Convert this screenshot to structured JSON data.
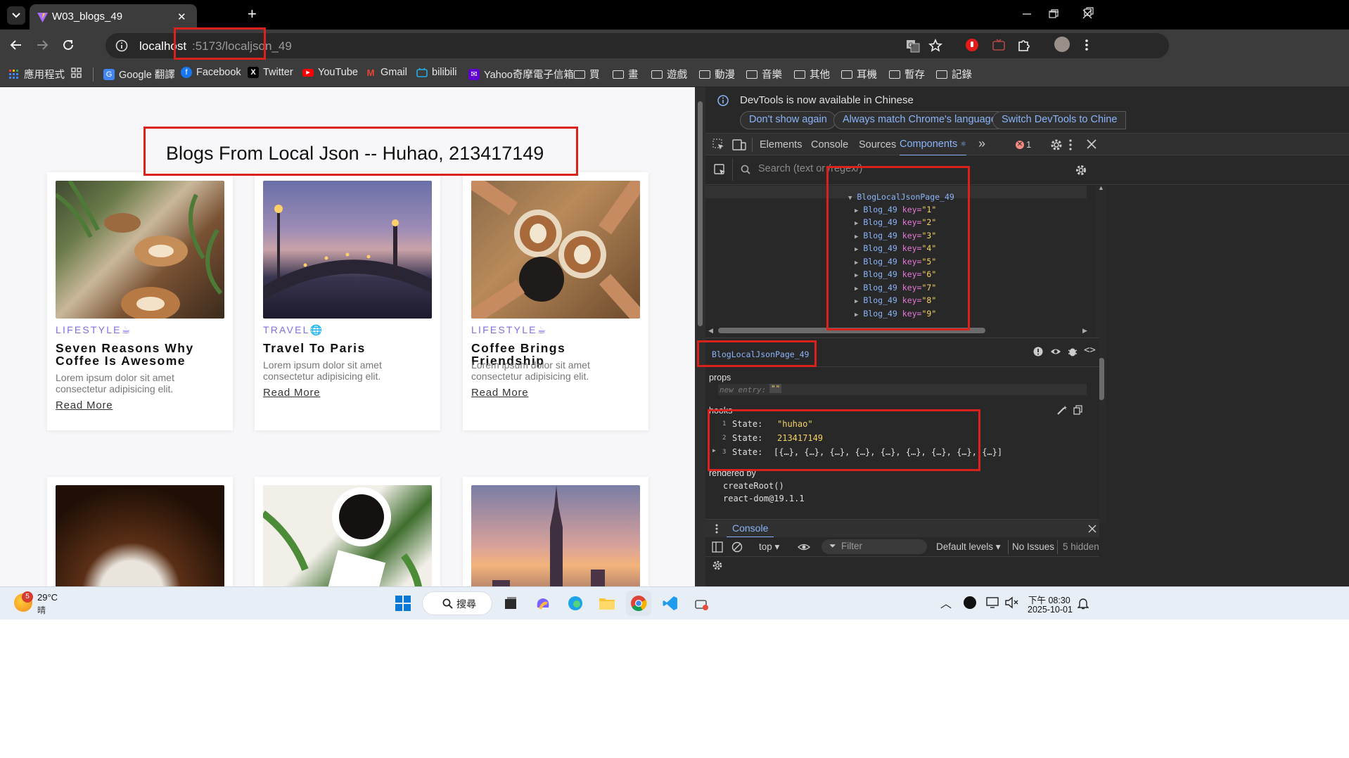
{
  "tab": {
    "title": "W03_blogs_49",
    "close": "✕",
    "new": "+"
  },
  "address": {
    "host": "localhost",
    "rest": ":5173/localjson_49"
  },
  "bookmarks": [
    {
      "label": "應用程式",
      "icon": "apps-grid-icon"
    },
    {
      "label": "",
      "icon": "grid-icon"
    },
    {
      "label": "Google 翻譯",
      "icon": "google-translate-icon"
    },
    {
      "label": "Facebook",
      "icon": "facebook-icon"
    },
    {
      "label": "Twitter",
      "icon": "x-twitter-icon"
    },
    {
      "label": "YouTube",
      "icon": "youtube-icon"
    },
    {
      "label": "Gmail",
      "icon": "gmail-icon"
    },
    {
      "label": "bilibili",
      "icon": "bilibili-icon"
    },
    {
      "label": "Yahoo奇摩電子信箱",
      "icon": "yahoo-icon"
    },
    {
      "label": "買",
      "icon": "folder-icon"
    },
    {
      "label": "畫",
      "icon": "folder-icon"
    },
    {
      "label": "遊戲",
      "icon": "folder-icon"
    },
    {
      "label": "動漫",
      "icon": "folder-icon"
    },
    {
      "label": "音樂",
      "icon": "folder-icon"
    },
    {
      "label": "其他",
      "icon": "folder-icon"
    },
    {
      "label": "耳機",
      "icon": "folder-icon"
    },
    {
      "label": "暫存",
      "icon": "folder-icon"
    },
    {
      "label": "記錄",
      "icon": "folder-icon"
    }
  ],
  "page": {
    "title": "Blogs From Local Json -- Huhao, 213417149",
    "cards": [
      {
        "category": "LIFESTYLE",
        "cat_icon": "coffee-cup-icon",
        "title": "Seven Reasons Why Coffee Is Awesome",
        "desc": "Lorem ipsum dolor sit amet consectetur adipisicing elit.",
        "link": "Read More"
      },
      {
        "category": "TRAVEL",
        "cat_icon": "globe-icon",
        "title": "Travel To Paris",
        "desc": "Lorem ipsum dolor sit amet consectetur adipisicing elit.",
        "link": "Read More"
      },
      {
        "category": "LIFESTYLE",
        "cat_icon": "coffee-cup-icon",
        "title": "Coffee Brings Friendship",
        "desc": "Lorem ipsum dolor sit amet consectetur adipisicing elit.",
        "link": "Read More"
      }
    ]
  },
  "devtools": {
    "info": "DevTools is now available in Chinese",
    "btn_dont_show": "Don't show again",
    "btn_match": "Always match Chrome's language",
    "btn_switch": "Switch DevTools to Chine",
    "tabs": [
      "Elements",
      "Console",
      "Sources",
      "Components"
    ],
    "error_count": "1",
    "search_placeholder": "Search (text or /regex/)",
    "tree_root": "BlogLocalJsonPage_49",
    "tree_children": [
      {
        "name": "Blog_49",
        "key": "key=",
        "val": "\"1\""
      },
      {
        "name": "Blog_49",
        "key": "key=",
        "val": "\"2\""
      },
      {
        "name": "Blog_49",
        "key": "key=",
        "val": "\"3\""
      },
      {
        "name": "Blog_49",
        "key": "key=",
        "val": "\"4\""
      },
      {
        "name": "Blog_49",
        "key": "key=",
        "val": "\"5\""
      },
      {
        "name": "Blog_49",
        "key": "key=",
        "val": "\"6\""
      },
      {
        "name": "Blog_49",
        "key": "key=",
        "val": "\"7\""
      },
      {
        "name": "Blog_49",
        "key": "key=",
        "val": "\"8\""
      },
      {
        "name": "Blog_49",
        "key": "key=",
        "val": "\"9\""
      }
    ],
    "selected": "BlogLocalJsonPage_49",
    "props_label": "props",
    "new_entry": "new entry:",
    "new_entry_val": "\"\"",
    "hooks_label": "hooks",
    "hooks": [
      {
        "idx": "1",
        "label": "State:",
        "val": "\"huhao\""
      },
      {
        "idx": "2",
        "label": "State:",
        "val": "213417149"
      },
      {
        "idx": "3",
        "label": "State:",
        "val": "[{…}, {…}, {…}, {…}, {…}, {…}, {…}, {…}, {…}]"
      }
    ],
    "rendered_by": "rendered by",
    "rendered_items": [
      "createRoot()",
      "react-dom@19.1.1"
    ],
    "console_tab": "Console",
    "console_top": "top ▾",
    "filter_placeholder": "Filter",
    "levels": "Default levels ▾",
    "issues": "No Issues",
    "hidden": "5 hidden"
  },
  "taskbar": {
    "temp": "29°C",
    "weather": "晴",
    "badge": "5",
    "search": "搜尋",
    "time": "下午 08:30",
    "date": "2025-10-01"
  }
}
